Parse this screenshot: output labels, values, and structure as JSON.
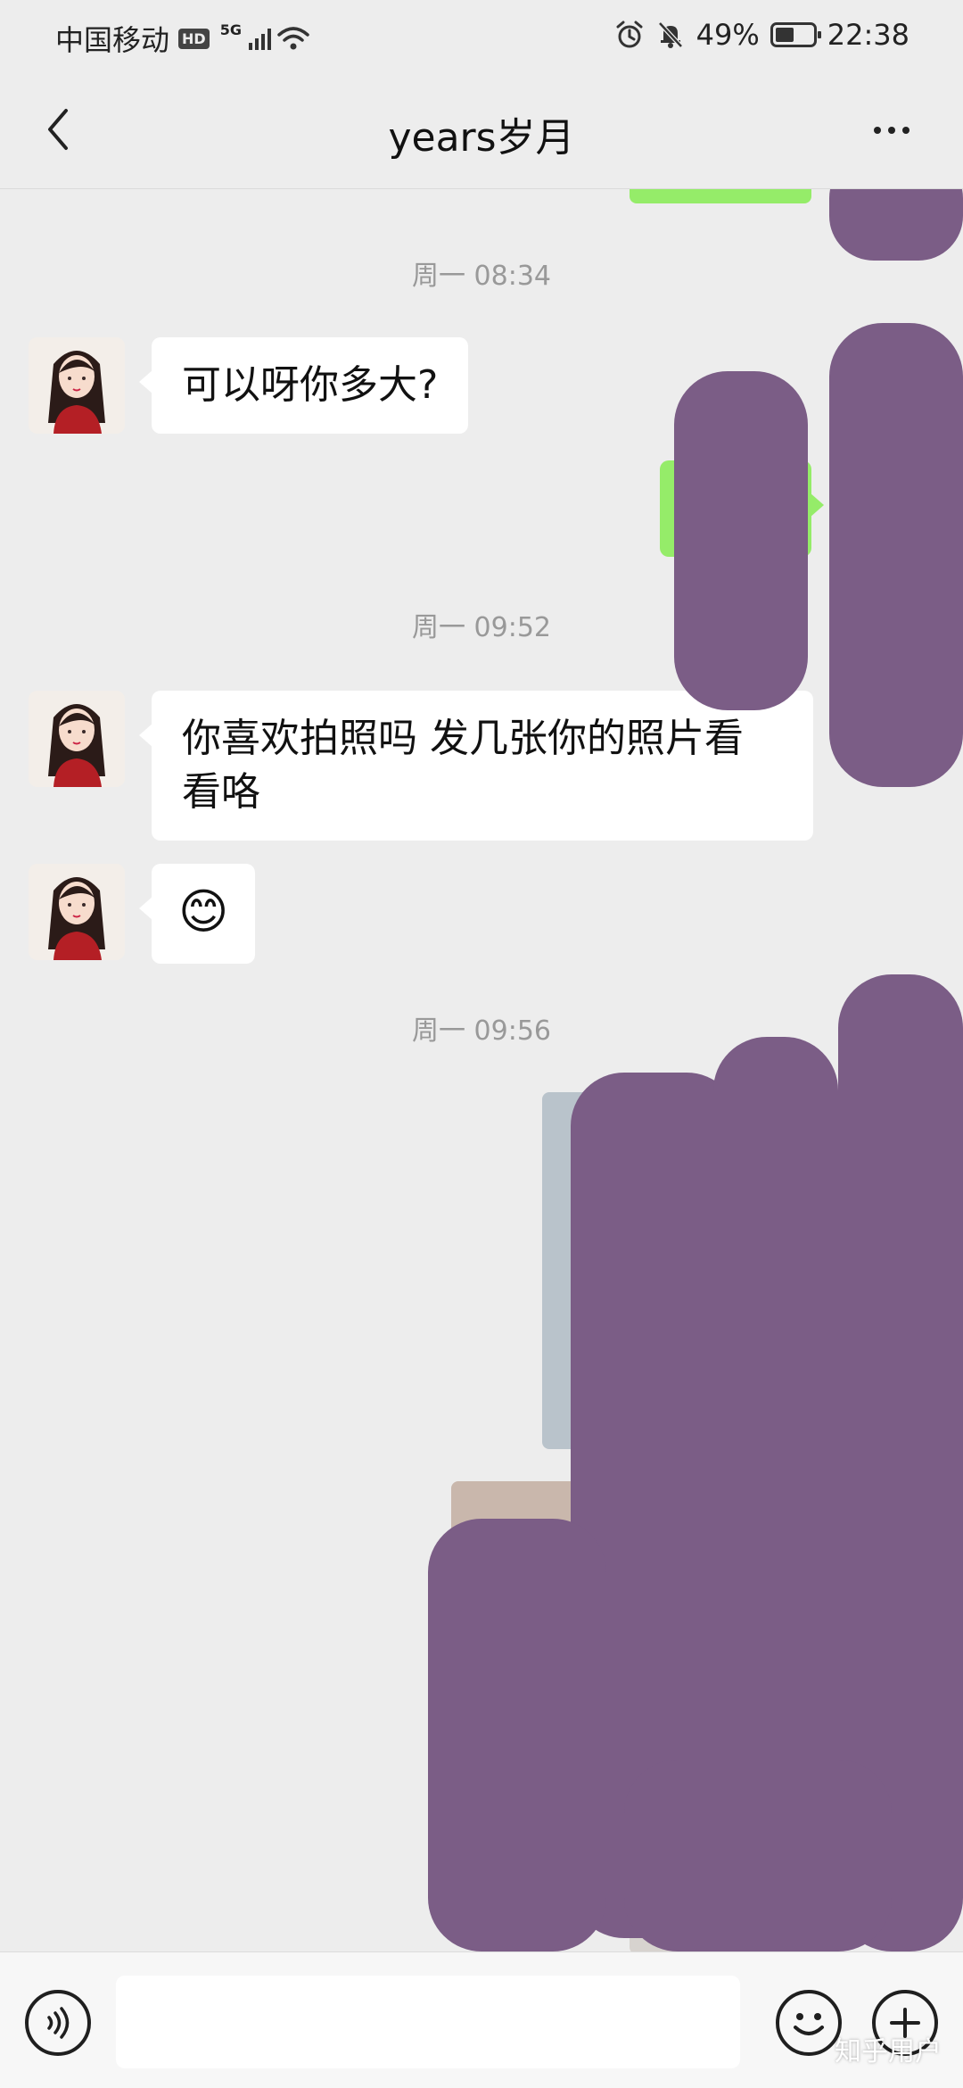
{
  "status_bar": {
    "carrier": "中国移动",
    "hd": "HD",
    "network": "5G",
    "battery": "49%",
    "battery_level": 0.49,
    "time": "22:38"
  },
  "header": {
    "title": "years岁月"
  },
  "messages": {
    "ts1": "周一 08:34",
    "msg1": "可以呀你多大?",
    "ts2": "周一 09:52",
    "msg2_line1": "你喜欢拍照吗 发几张你的照片看",
    "msg2_line2": "看咯",
    "msg3_emoji": "😊",
    "ts3": "周一 09:56"
  },
  "icons": {
    "back": "chevron-left-icon",
    "more": "more-dots-icon",
    "voice": "voice-icon",
    "emoji": "emoji-icon",
    "plus": "plus-icon"
  },
  "colors": {
    "outgoing_bubble": "#95ec69",
    "incoming_bubble": "#ffffff",
    "background": "#ededed",
    "redaction": "#7b5d86"
  },
  "watermark": "知乎用户"
}
